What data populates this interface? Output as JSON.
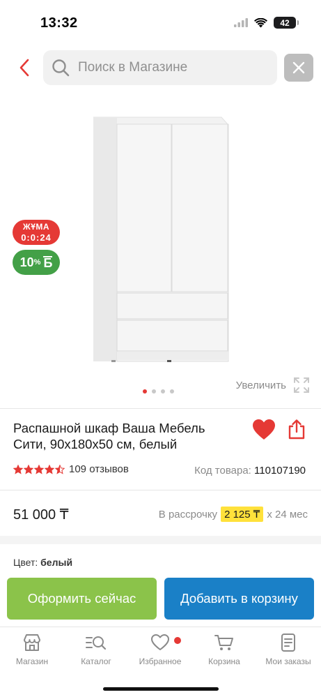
{
  "status_bar": {
    "time": "13:32",
    "battery": "42",
    "icons": [
      "cellular-icon",
      "wifi-icon",
      "battery-icon"
    ]
  },
  "search": {
    "placeholder": "Поиск в Магазине"
  },
  "gallery": {
    "promo_friday_label": "ЖҰМА",
    "promo_friday_timer": "0:0:24",
    "promo_bonus_percent": "10",
    "promo_bonus_symbol": "%",
    "promo_bonus_currency": "Б",
    "slide_count": 4,
    "active_slide": 1,
    "zoom_label": "Увеличить"
  },
  "product": {
    "title": "Распашной шкаф Ваша Мебель Сити, 90х180х50 см, белый",
    "rating": 4.5,
    "rating_max": 5,
    "reviews": "109 отзывов",
    "sku_label": "Код товара:",
    "sku_value": "110107190",
    "price": "51 000 ₸",
    "installment_prefix": "В рассрочку",
    "installment_amount": "2 125 ₸",
    "installment_suffix": "х 24 мес",
    "color_label": "Цвет:",
    "color_value": "белый"
  },
  "actions": {
    "buy_now": "Оформить сейчас",
    "add_to_cart": "Добавить в корзину"
  },
  "tabs": [
    {
      "label": "Магазин",
      "icon": "store-icon"
    },
    {
      "label": "Каталог",
      "icon": "catalog-search-icon"
    },
    {
      "label": "Избранное",
      "icon": "heart-icon",
      "badge": true
    },
    {
      "label": "Корзина",
      "icon": "cart-icon"
    },
    {
      "label": "Мои заказы",
      "icon": "orders-icon"
    }
  ],
  "colors": {
    "accent_red": "#e53935",
    "buy_green": "#8bc34a",
    "cart_blue": "#1a80c7",
    "bonus_green": "#43a047",
    "installment_yellow": "#ffe13b",
    "star": "#e53935"
  }
}
